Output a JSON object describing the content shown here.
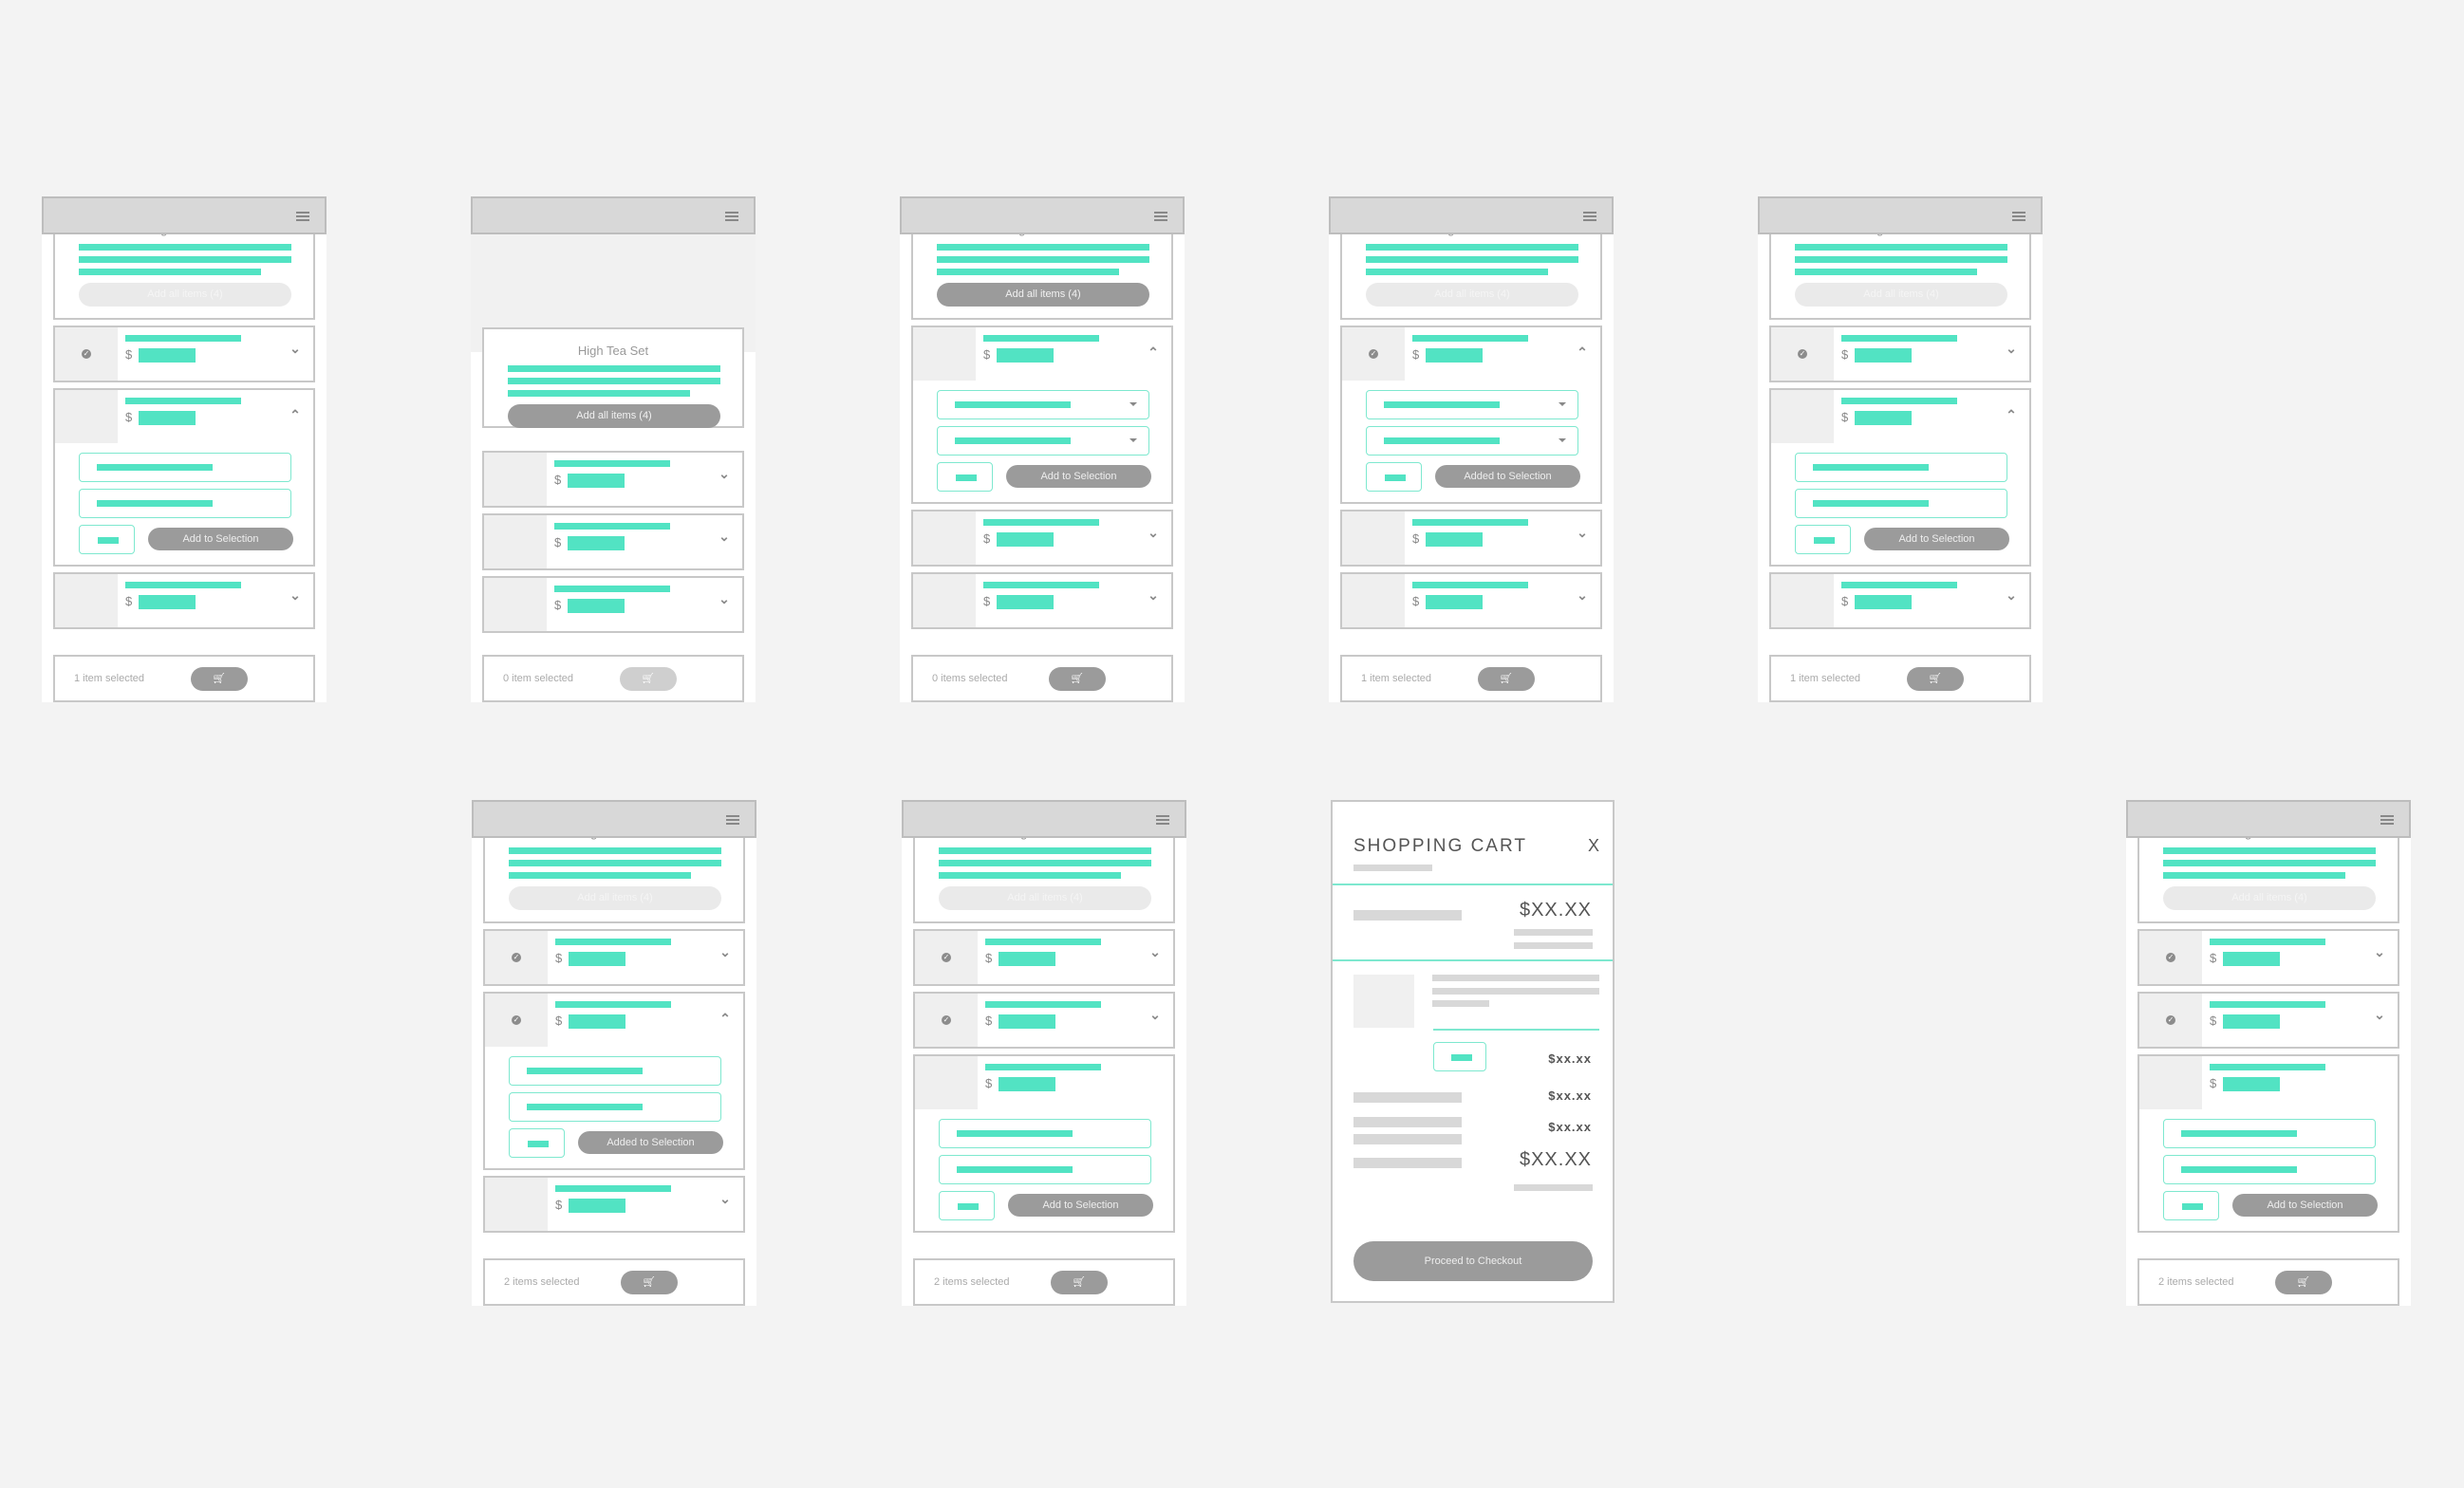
{
  "colors": {
    "accent": "#52e3c3",
    "accent_border": "#7ee8cf",
    "button_gray": "#9b9b9b",
    "header_gray": "#d8d8d8",
    "background": "#f3f3f3"
  },
  "common": {
    "set_title": "High Tea Set",
    "add_all_label": "Add all items (4)",
    "currency_symbol": "$",
    "add_label": "Add to Selection",
    "added_label": "Added to Selection",
    "menu_icon": "hamburger-icon",
    "cart_icon": "cart-icon",
    "check_icon": "check-circle-icon"
  },
  "screens": [
    {
      "id": "s1",
      "add_all_state": "disabled",
      "selected_label": "1 item selected",
      "cart_enabled": true,
      "items": [
        {
          "checked": true,
          "expanded": false
        },
        {
          "checked": false,
          "expanded": true,
          "button": "add"
        },
        {
          "checked": false,
          "expanded": false
        }
      ]
    },
    {
      "id": "s2",
      "overlay": true,
      "add_all_state": "active",
      "selected_label": "0 item selected",
      "cart_enabled": false,
      "items": [
        {
          "checked": false,
          "expanded": false
        },
        {
          "checked": false,
          "expanded": false
        },
        {
          "checked": false,
          "expanded": false
        }
      ]
    },
    {
      "id": "s3",
      "add_all_state": "active",
      "selected_label": "0 items selected",
      "cart_enabled": true,
      "items": [
        {
          "checked": false,
          "expanded": true,
          "button": "add",
          "dropdowns": true
        },
        {
          "checked": false,
          "expanded": false
        },
        {
          "checked": false,
          "expanded": false
        }
      ]
    },
    {
      "id": "s4",
      "add_all_state": "disabled",
      "selected_label": "1 item selected",
      "cart_enabled": true,
      "items": [
        {
          "checked": true,
          "expanded": true,
          "button": "added",
          "dropdowns": true
        },
        {
          "checked": false,
          "expanded": false
        },
        {
          "checked": false,
          "expanded": false
        }
      ]
    },
    {
      "id": "s5",
      "add_all_state": "disabled",
      "selected_label": "1 item selected",
      "cart_enabled": true,
      "items": [
        {
          "checked": true,
          "expanded": false
        },
        {
          "checked": false,
          "expanded": true,
          "button": "add"
        },
        {
          "checked": false,
          "expanded": false
        }
      ]
    },
    {
      "id": "s6",
      "add_all_state": "disabled",
      "selected_label": "2 items selected",
      "cart_enabled": true,
      "items": [
        {
          "checked": true,
          "expanded": false
        },
        {
          "checked": true,
          "expanded": true,
          "button": "added"
        },
        {
          "checked": false,
          "expanded": false
        }
      ]
    },
    {
      "id": "s7",
      "add_all_state": "disabled",
      "selected_label": "2 items selected",
      "cart_enabled": true,
      "items": [
        {
          "checked": true,
          "expanded": false
        },
        {
          "checked": true,
          "expanded": false
        },
        {
          "checked": false,
          "expanded": true,
          "button": "add",
          "noChevron": true
        }
      ]
    },
    {
      "id": "s9",
      "add_all_state": "disabled",
      "selected_label": "2 items selected",
      "cart_enabled": true,
      "items": [
        {
          "checked": true,
          "expanded": false
        },
        {
          "checked": true,
          "expanded": false
        },
        {
          "checked": false,
          "expanded": true,
          "button": "add",
          "noChevron": true
        }
      ]
    }
  ],
  "cart": {
    "title": "SHOPPING CART",
    "close_label": "X",
    "subtotal": "$XX.XX",
    "line_price": "$xx.xx",
    "summary_1": "$xx.xx",
    "summary_2": "$xx.xx",
    "total": "$XX.XX",
    "checkout_label": "Proceed to Checkout"
  }
}
